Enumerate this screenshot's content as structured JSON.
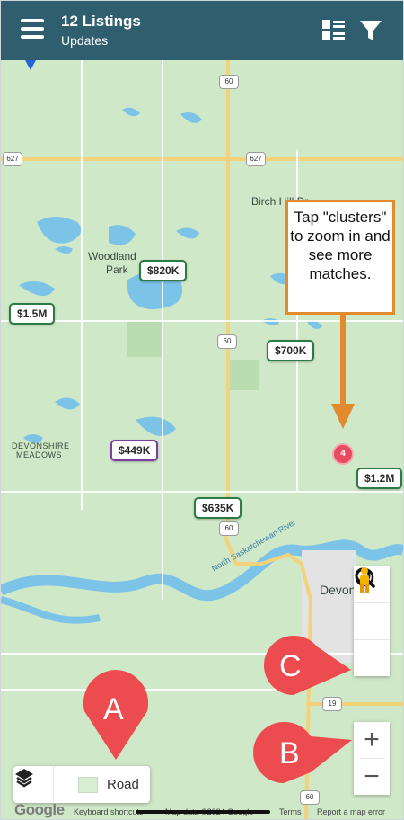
{
  "header": {
    "title": "12 Listings",
    "subtitle": "Updates",
    "menu_icon": "hamburger-menu-icon",
    "list_icon": "list-view-icon",
    "filter_icon": "filter-icon"
  },
  "colors": {
    "header_bg": "#2f5f6f",
    "map_bg": "#cfe8c8",
    "water": "#7cc3e8",
    "road_yellow": "#f2d27a",
    "tag_border_green": "#2c7a44",
    "tag_border_purple": "#7a3fa0",
    "cluster_red": "#e84a5f",
    "callout_red": "#ec4b4f",
    "tooltip_orange": "#e28b2e"
  },
  "map": {
    "places": {
      "birch_hills": "Birch Hill Dr",
      "woodland": "Woodland",
      "park": "Park",
      "devonshire": "DEVONSHIRE",
      "meadows": "MEADOWS",
      "devon": "Devon",
      "river": "North Saskatchewan River"
    },
    "highways": {
      "h60_top": "60",
      "h627_left": "627",
      "h627_mid": "627",
      "h60_mid": "60",
      "h60_lower": "60",
      "h19": "19",
      "h60_bottom": "60"
    },
    "listings": [
      {
        "price": "$820K"
      },
      {
        "price": "$1.5M"
      },
      {
        "price": "$700K"
      },
      {
        "price": "$449K"
      },
      {
        "price": "$1.2M"
      },
      {
        "price": "$635K"
      }
    ],
    "cluster_count": "4"
  },
  "tooltip": {
    "text": "Tap \"clusters\" to zoom in and see more matches."
  },
  "controls": {
    "search_icon": "search-icon",
    "locate_icon": "navigation-arrow-icon",
    "street_view_icon": "pegman-icon",
    "zoom_in_label": "+",
    "zoom_out_label": "−"
  },
  "callouts": {
    "a": "A",
    "b": "B",
    "c": "C"
  },
  "layers": {
    "layers_icon": "layers-icon",
    "road_label": "Road"
  },
  "attribution": {
    "google": "Google",
    "keyboard": "Keyboard shortcuts",
    "map_data": "Map data ©2024 Google",
    "terms": "Terms",
    "report": "Report a map error"
  }
}
